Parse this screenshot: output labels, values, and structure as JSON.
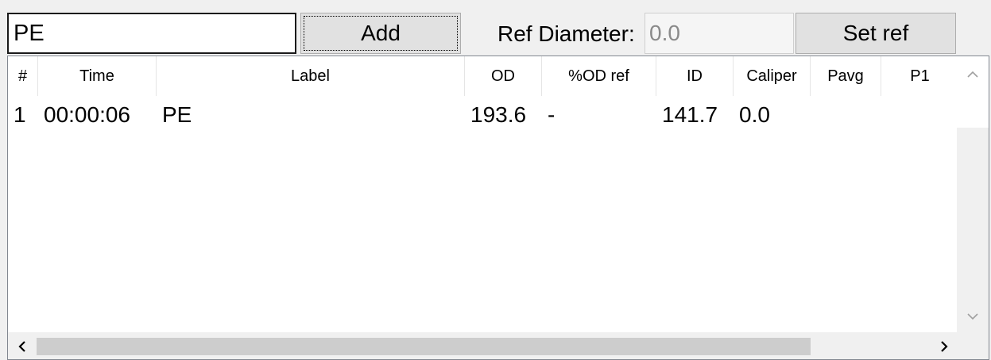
{
  "toolbar": {
    "label_input_value": "PE",
    "add_label": "Add",
    "ref_diameter_label": "Ref Diameter:",
    "ref_diameter_value": "0.0",
    "set_ref_label": "Set ref"
  },
  "table": {
    "columns": [
      "#",
      "Time",
      "Label",
      "OD",
      "%OD ref",
      "ID",
      "Caliper",
      "Pavg",
      "P1"
    ],
    "rows": [
      [
        "1",
        "00:00:06",
        "PE",
        "193.6",
        "-",
        "141.7",
        "0.0",
        "",
        ""
      ]
    ]
  },
  "icons": {
    "scroll_up": "chevron-up-icon",
    "scroll_down": "chevron-down-icon",
    "scroll_left": "chevron-left-icon",
    "scroll_right": "chevron-right-icon"
  },
  "colors": {
    "window_bg": "#f0f0f0",
    "button_bg": "#e1e1e1",
    "list_bg": "#ffffff",
    "disabled_text": "#8a8a8a"
  }
}
